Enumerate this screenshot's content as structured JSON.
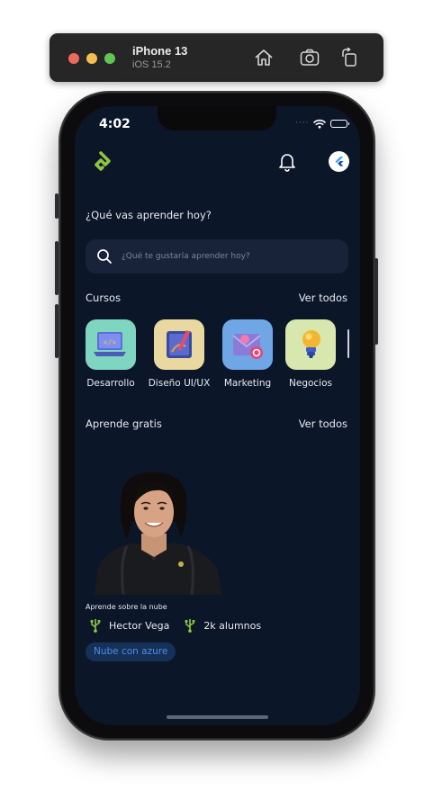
{
  "simulator": {
    "device": "iPhone 13",
    "os": "iOS 15.2",
    "buttons": [
      "home-icon",
      "screenshot-icon",
      "rotate-icon"
    ]
  },
  "status_bar": {
    "time": "4:02",
    "signal_dots": "····"
  },
  "header": {
    "logo_icon": "app-logo-icon",
    "notification_icon": "bell-icon",
    "profile_icon": "flutter-avatar-icon",
    "accent_color": "#8dc63f"
  },
  "prompt": "¿Qué vas aprender hoy?",
  "search": {
    "placeholder": "¿Qué te gustaría aprender hoy?",
    "value": ""
  },
  "courses_section": {
    "title": "Cursos",
    "see_all": "Ver todos",
    "items": [
      {
        "label": "Desarrollo",
        "icon": "laptop-code-icon",
        "bg": "#7fd6c0"
      },
      {
        "label": "Diseño UI/UX",
        "icon": "design-tablet-icon",
        "bg": "#e9d9a1"
      },
      {
        "label": "Marketing",
        "icon": "mail-marketing-icon",
        "bg": "#6fa6e6"
      },
      {
        "label": "Negocios",
        "icon": "lightbulb-icon",
        "bg": "#d7e7ad"
      }
    ]
  },
  "free_section": {
    "title": "Aprende gratis",
    "see_all": "Ver todos",
    "card": {
      "title": "Aprende sobre la nube",
      "instructor": "Hector Vega",
      "students": "2k alumnos",
      "tag": "Nube con azure",
      "meta_icon": "usb-icon",
      "meta_color": "#8dc63f",
      "tag_text_color": "#4a8fe6"
    }
  }
}
